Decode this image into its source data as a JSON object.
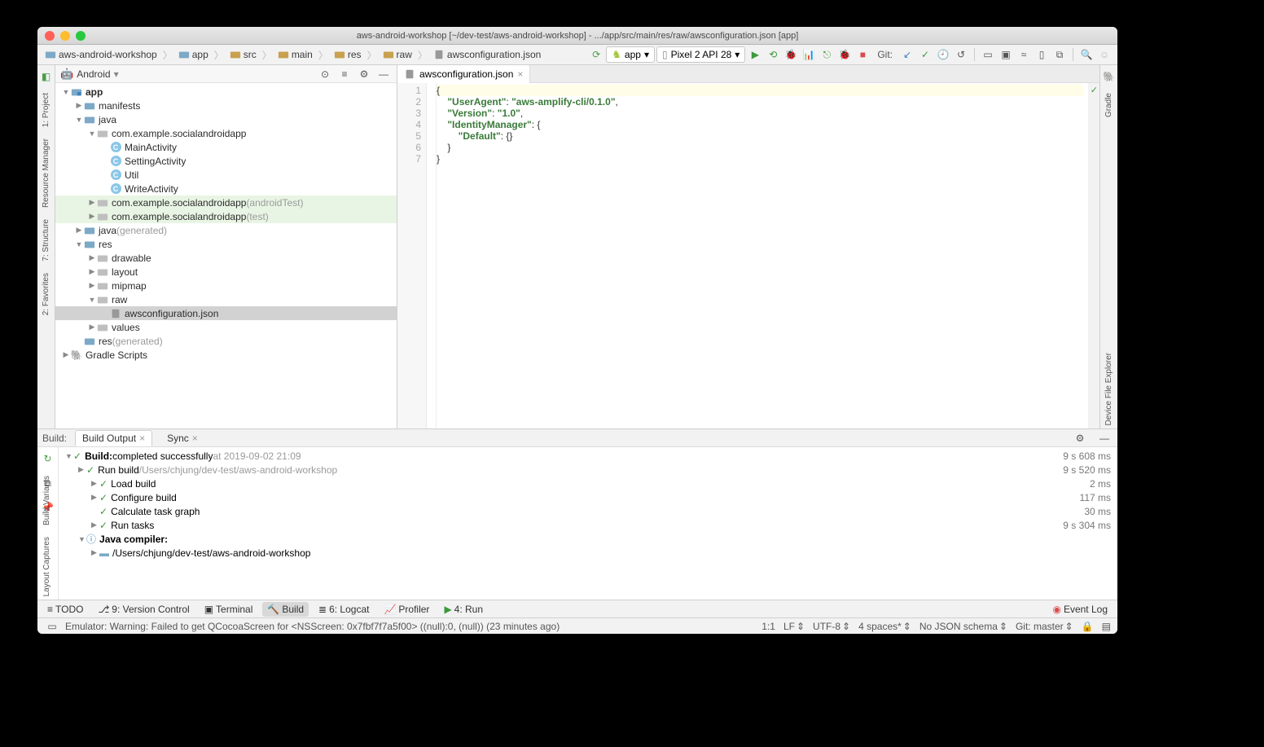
{
  "title": "aws-android-workshop [~/dev-test/aws-android-workshop] - .../app/src/main/res/raw/awsconfiguration.json [app]",
  "breadcrumb": [
    "aws-android-workshop",
    "app",
    "src",
    "main",
    "res",
    "raw",
    "awsconfiguration.json"
  ],
  "runConfig": {
    "app": "app",
    "device": "Pixel 2 API 28",
    "git": "Git:"
  },
  "leftTabs": [
    "1: Project",
    "Resource Manager",
    "7: Structure",
    "2: Favorites"
  ],
  "rightTabs": [
    "Gradle"
  ],
  "projectPanel": {
    "label": "Android"
  },
  "tree": [
    {
      "d": 0,
      "a": "▼",
      "i": "mod",
      "t": "app",
      "b": true
    },
    {
      "d": 1,
      "a": "▶",
      "i": "fld",
      "t": "manifests"
    },
    {
      "d": 1,
      "a": "▼",
      "i": "fld",
      "t": "java"
    },
    {
      "d": 2,
      "a": "▼",
      "i": "pkg",
      "t": "com.example.socialandroidapp"
    },
    {
      "d": 3,
      "a": "",
      "i": "cls",
      "t": "MainActivity"
    },
    {
      "d": 3,
      "a": "",
      "i": "cls",
      "t": "SettingActivity"
    },
    {
      "d": 3,
      "a": "",
      "i": "cls",
      "t": "Util"
    },
    {
      "d": 3,
      "a": "",
      "i": "cls",
      "t": "WriteActivity"
    },
    {
      "d": 2,
      "a": "▶",
      "i": "pkg",
      "t": "com.example.socialandroidapp",
      "suf": "(androidTest)",
      "hl": true
    },
    {
      "d": 2,
      "a": "▶",
      "i": "pkg",
      "t": "com.example.socialandroidapp",
      "suf": "(test)",
      "hl": true
    },
    {
      "d": 1,
      "a": "▶",
      "i": "fld",
      "t": "java",
      "suf": "(generated)"
    },
    {
      "d": 1,
      "a": "▼",
      "i": "fld",
      "t": "res"
    },
    {
      "d": 2,
      "a": "▶",
      "i": "pkg",
      "t": "drawable"
    },
    {
      "d": 2,
      "a": "▶",
      "i": "pkg",
      "t": "layout"
    },
    {
      "d": 2,
      "a": "▶",
      "i": "pkg",
      "t": "mipmap"
    },
    {
      "d": 2,
      "a": "▼",
      "i": "pkg",
      "t": "raw"
    },
    {
      "d": 3,
      "a": "",
      "i": "json",
      "t": "awsconfiguration.json",
      "sel": true
    },
    {
      "d": 2,
      "a": "▶",
      "i": "pkg",
      "t": "values"
    },
    {
      "d": 1,
      "a": "",
      "i": "fld",
      "t": "res",
      "suf": "(generated)"
    },
    {
      "d": 0,
      "a": "▶",
      "i": "gradle",
      "t": "Gradle Scripts"
    }
  ],
  "editorTab": "awsconfiguration.json",
  "codeLines": [
    "1",
    "2",
    "3",
    "4",
    "5",
    "6",
    "7"
  ],
  "code": {
    "l1": "{",
    "l2a": "    \"UserAgent\"",
    "l2b": ": ",
    "l2c": "\"aws-amplify-cli/0.1.0\"",
    "l2d": ",",
    "l3a": "    \"Version\"",
    "l3b": ": ",
    "l3c": "\"1.0\"",
    "l3d": ",",
    "l4a": "    \"IdentityManager\"",
    "l4b": ": {",
    "l5a": "        \"Default\"",
    "l5b": ": {}",
    "l6": "    }",
    "l7": "}"
  },
  "buildPanel": {
    "label": "Build:",
    "tabs": [
      "Build Output",
      "Sync"
    ],
    "rows": [
      {
        "d": 0,
        "a": "▼",
        "c": true,
        "b": "Build:",
        "t": " completed successfully ",
        "g": "at 2019-09-02 21:09",
        "tm": "9 s 608 ms"
      },
      {
        "d": 1,
        "a": "▶",
        "c": true,
        "t": "Run build ",
        "g": "/Users/chjung/dev-test/aws-android-workshop",
        "tm": "9 s 520 ms"
      },
      {
        "d": 2,
        "a": "▶",
        "c": true,
        "t": "Load build",
        "tm": "2 ms"
      },
      {
        "d": 2,
        "a": "▶",
        "c": true,
        "t": "Configure build",
        "tm": "117 ms"
      },
      {
        "d": 2,
        "a": "",
        "c": true,
        "t": "Calculate task graph",
        "tm": "30 ms"
      },
      {
        "d": 2,
        "a": "▶",
        "c": true,
        "t": "Run tasks",
        "tm": "9 s 304 ms"
      },
      {
        "d": 1,
        "a": "▼",
        "info": true,
        "b": "Java compiler:",
        "t": ""
      },
      {
        "d": 2,
        "a": "▶",
        "fld": true,
        "t": "/Users/chjung/dev-test/aws-android-workshop"
      }
    ]
  },
  "bottomBar": {
    "todo": "TODO",
    "vc": "9: Version Control",
    "term": "Terminal",
    "build": "Build",
    "logcat": "6: Logcat",
    "profiler": "Profiler",
    "run": "4: Run",
    "eventLog": "Event Log"
  },
  "statusBar": {
    "msg": "Emulator: Warning: Failed to get QCocoaScreen for <NSScreen: 0x7fbf7f7a5f00> ((null):0, (null)) (23 minutes ago)",
    "pos": "1:1",
    "le": "LF",
    "enc": "UTF-8",
    "indent": "4 spaces*",
    "schema": "No JSON schema",
    "git": "Git: master"
  },
  "rightBottomTab": "Device File Explorer",
  "leftBottomTabs": [
    "Build Variants",
    "Layout Captures"
  ]
}
